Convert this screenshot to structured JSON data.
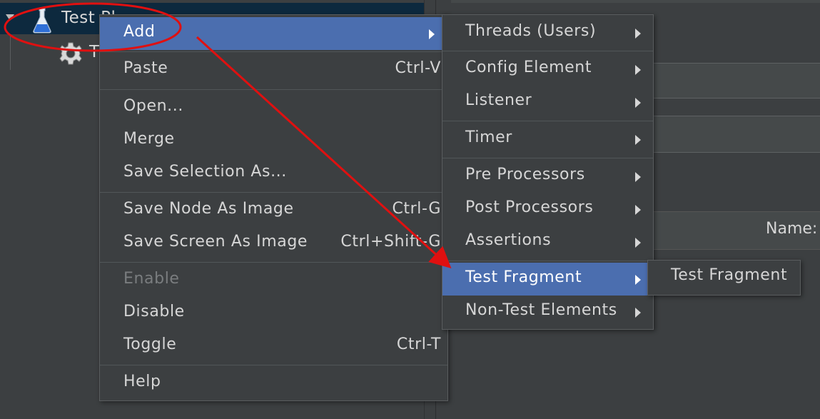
{
  "tree": {
    "items": [
      {
        "label": "Test Pl",
        "icon": "flask-icon"
      },
      {
        "label": "T",
        "icon": "gear-icon"
      }
    ]
  },
  "right_panel": {
    "name_label": "Name:"
  },
  "context_menu": {
    "items": [
      {
        "label": "Add",
        "shortcut": "",
        "has_submenu": true,
        "selected": true,
        "enabled": true
      },
      {
        "label": "Paste",
        "shortcut": "Ctrl-V",
        "enabled": true
      },
      {
        "label": "Open...",
        "shortcut": "",
        "enabled": true
      },
      {
        "label": "Merge",
        "shortcut": "",
        "enabled": true
      },
      {
        "label": "Save Selection As...",
        "shortcut": "",
        "enabled": true
      },
      {
        "label": "Save Node As Image",
        "shortcut": "Ctrl-G",
        "enabled": true
      },
      {
        "label": "Save Screen As Image",
        "shortcut": "Ctrl+Shift-G",
        "enabled": true
      },
      {
        "label": "Enable",
        "shortcut": "",
        "enabled": false
      },
      {
        "label": "Disable",
        "shortcut": "",
        "enabled": true
      },
      {
        "label": "Toggle",
        "shortcut": "Ctrl-T",
        "enabled": true
      },
      {
        "label": "Help",
        "shortcut": "",
        "enabled": true
      }
    ]
  },
  "add_submenu": {
    "items": [
      {
        "label": "Threads (Users)",
        "has_submenu": true
      },
      {
        "label": "Config Element",
        "has_submenu": true
      },
      {
        "label": "Listener",
        "has_submenu": true
      },
      {
        "label": "Timer",
        "has_submenu": true
      },
      {
        "label": "Pre Processors",
        "has_submenu": true
      },
      {
        "label": "Post Processors",
        "has_submenu": true
      },
      {
        "label": "Assertions",
        "has_submenu": true
      },
      {
        "label": "Test Fragment",
        "has_submenu": true,
        "selected": true
      },
      {
        "label": "Non-Test Elements",
        "has_submenu": true
      }
    ]
  },
  "test_fragment_submenu": {
    "items": [
      {
        "label": "Test Fragment"
      }
    ]
  },
  "colors": {
    "background": "#3c3f41",
    "selection": "#4b6eaf",
    "tree_selection": "#0d293e",
    "annotation": "#e01010",
    "text": "#d6d6d6",
    "disabled_text": "#7a7d7f"
  }
}
